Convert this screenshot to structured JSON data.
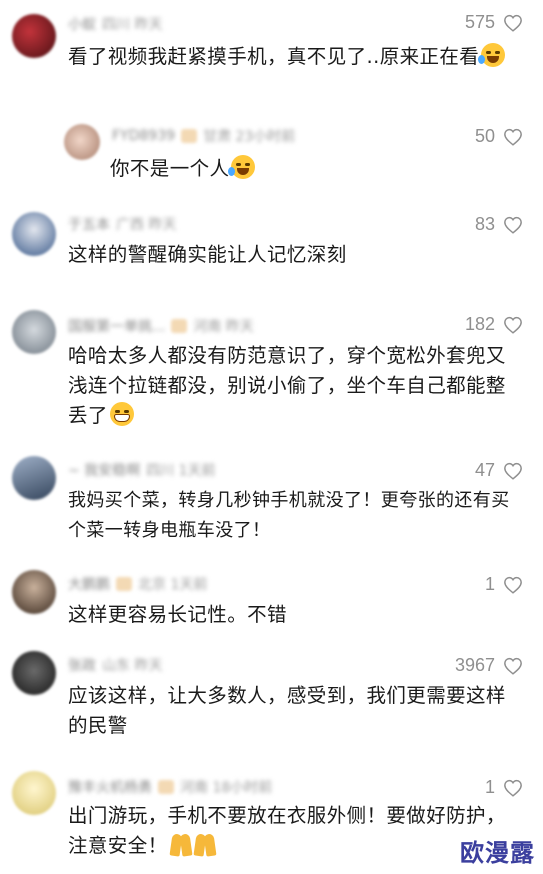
{
  "comments": [
    {
      "username": "小蚁",
      "location": "四川 昨天",
      "likes": "575",
      "text": "看了视频我赶紧摸手机，真不见了..原来正在看",
      "emoji": "laugh-cry",
      "avatar_color": "#7a1e22",
      "reply": false
    },
    {
      "username": "FYD8939",
      "location": "甘肃 23小时前",
      "likes": "50",
      "text": "你不是一个人",
      "emoji": "laugh-cry",
      "avatar_color": "#c7a08a",
      "reply": true
    },
    {
      "username": "于五本",
      "location": "广西 昨天",
      "likes": "83",
      "text": "这样的警醒确实能让人记忆深刻",
      "emoji": "",
      "avatar_color": "#3a5a8a",
      "reply": false
    },
    {
      "username": "国服第一单挑...",
      "location": "河南 昨天",
      "likes": "182",
      "text": "哈哈太多人都没有防范意识了，穿个宽松外套兜又浅连个拉链都没，别说小偷了，坐个车自己都能整丢了",
      "emoji": "grin",
      "avatar_color": "#9aa4ad",
      "reply": false
    },
    {
      "username": "~ 我安稳啊",
      "location": "四川 1天前",
      "likes": "47",
      "text": "我妈买个菜，转身几秒钟手机就没了！更夸张的还有买个菜一转身电瓶车没了！",
      "emoji": "",
      "avatar_color": "#5c6e86",
      "reply": false
    },
    {
      "username": "大鹏鹏",
      "location": "北京 1天前",
      "likes": "1",
      "text": "这样更容易长记性。不错",
      "emoji": "",
      "avatar_color": "#6b5444",
      "reply": false
    },
    {
      "username": "张政",
      "location": "山东 昨天",
      "likes": "3967",
      "text": "应该这样，让大多数人，感受到，我们更需要这样的民警",
      "emoji": "",
      "avatar_color": "#2e2e2e",
      "reply": false
    },
    {
      "username": "豫丰火机杨勇",
      "location": "河南 18小时前",
      "likes": "1",
      "text": "出门游玩，手机不要放在衣服外侧！要做好防护，注意安全！",
      "emoji": "pray-pray",
      "avatar_color": "#e9d98a",
      "reply": false
    }
  ],
  "watermark": "欧漫露",
  "heart_color": "#8f8f8f"
}
